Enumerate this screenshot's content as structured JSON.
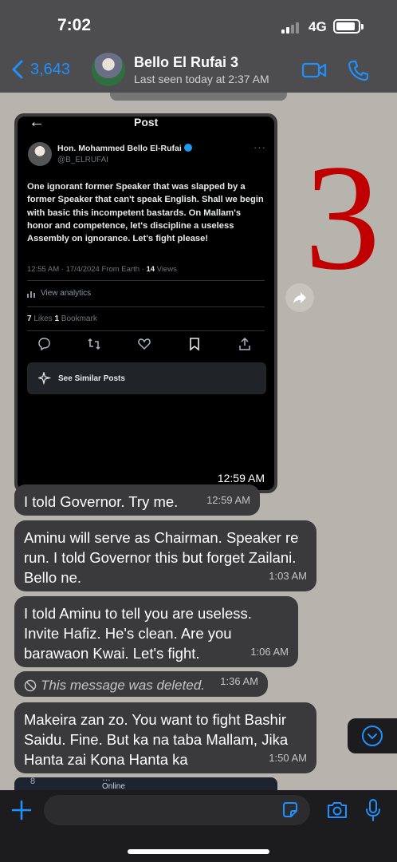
{
  "status_bar": {
    "time": "7:02",
    "network": "4G"
  },
  "header": {
    "back_count": "3,643",
    "contact_name": "Bello El Rufai 3",
    "last_seen": "Last seen today at 2:37 AM"
  },
  "image_message": {
    "time": "12:59 AM",
    "tweet": {
      "screen_title": "Post",
      "author_name": "Hon. Mohammed Bello El-Rufai",
      "handle": "@B_ELRUFAI",
      "text": "One ignorant former Speaker that was slapped by a former Speaker that can't speak English. Shall we begin with basic this incompetent bastards. On Mallam's honor and competence, let's discipline a useless Assembly on ignorance. Let's fight please!",
      "meta": "12:55 AM · 17/4/2024 From Earth · ",
      "views_count": "14",
      "views_label": " Views",
      "analytics_label": "View analytics",
      "likes_count": "7",
      "likes_label": " Likes  ",
      "bookmarks_count": "1",
      "bookmarks_label": " Bookmark",
      "similar_posts_label": "See Similar Posts"
    }
  },
  "overlay_number": "3",
  "messages": [
    {
      "text": "I told Governor. Try me.",
      "time": "12:59 AM"
    },
    {
      "text": "Aminu will serve as Chairman. Speaker re run. I told Governor this but forget Zailani. Bello ne.",
      "time": "1:03 AM"
    },
    {
      "text": "I told Aminu to tell you are useless. Invite Hafiz. He's clean. Are you barawaon Kwai. Let's fight.",
      "time": "1:06 AM"
    },
    {
      "text": "This message was deleted.",
      "time": "1:36 AM"
    },
    {
      "text": "Makeira zan zo. You want to fight Bashir Saidu. Fine. But ka na taba Mallam, Jika Hanta zai Kona Hanta ka",
      "time": "1:50 AM"
    }
  ],
  "peek_bubble": {
    "count": "8",
    "name": "…",
    "sub": "Online"
  },
  "input": {
    "placeholder": ""
  },
  "colors": {
    "accent": "#1e90ff",
    "chat_background": "#b7b4ad",
    "bubble": "#3a3a3c",
    "overlay_number": "#c00000"
  }
}
